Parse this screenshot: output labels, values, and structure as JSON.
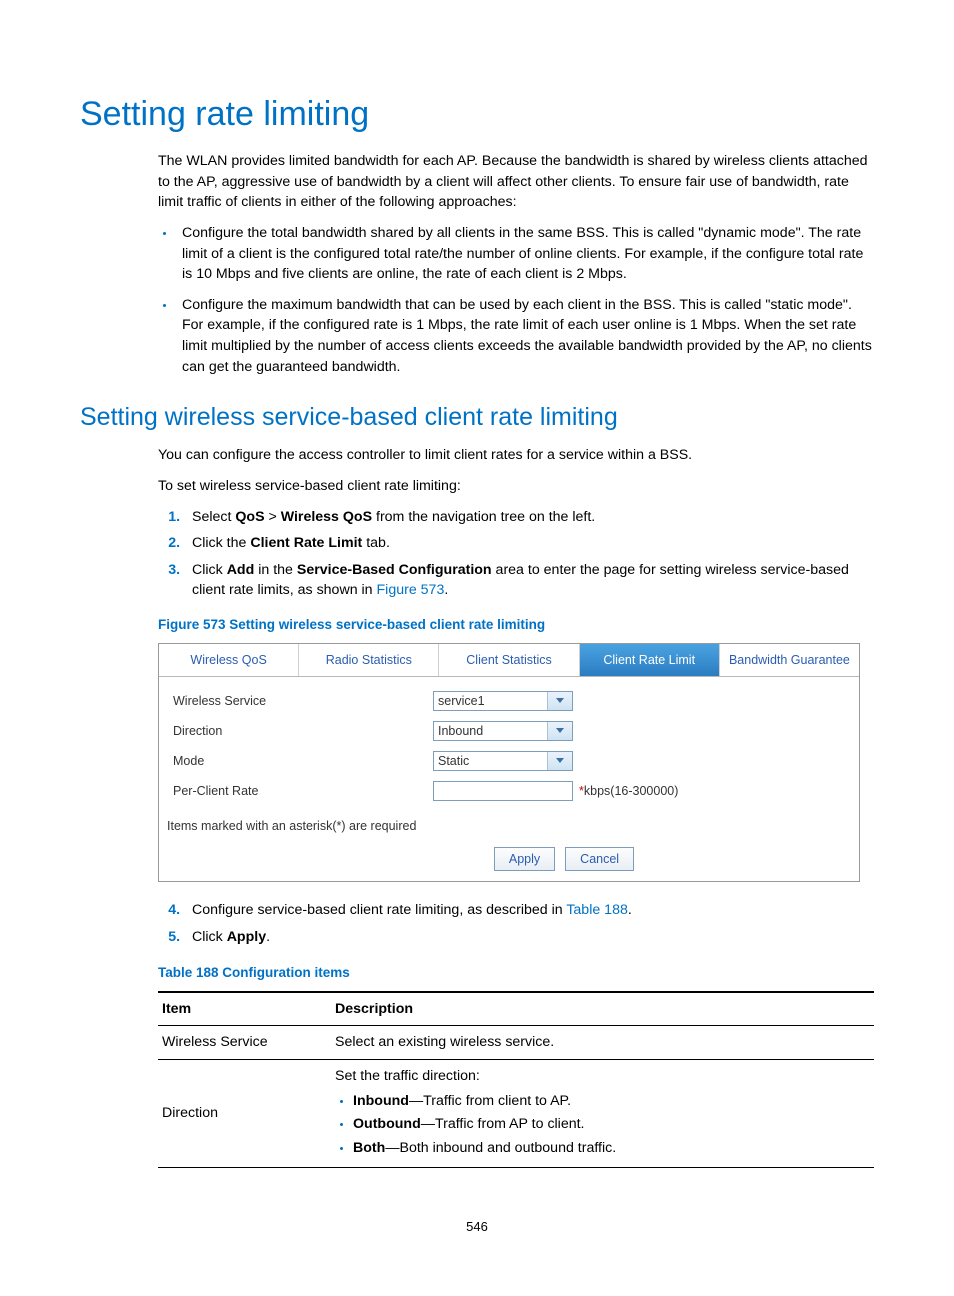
{
  "h1": "Setting rate limiting",
  "intro": "The WLAN provides limited bandwidth for each AP. Because the bandwidth is shared by wireless clients attached to the AP, aggressive use of bandwidth by a client will affect other clients. To ensure fair use of bandwidth, rate limit traffic of clients in either of the following approaches:",
  "bullets": [
    "Configure the total bandwidth shared by all clients in the same BSS. This is called \"dynamic mode\". The rate limit of a client is the configured total rate/the number of online clients. For example, if the configure total rate is 10 Mbps and five clients are online, the rate of each client is 2 Mbps.",
    "Configure the maximum bandwidth that can be used by each client in the BSS. This is called \"static mode\". For example, if the configured rate is 1 Mbps, the rate limit of each user online is 1 Mbps. When the set rate limit multiplied by the number of access clients exceeds the available bandwidth provided by the AP, no clients can get the guaranteed bandwidth."
  ],
  "h2": "Setting wireless service-based client rate limiting",
  "p2a": "You can configure the access controller to limit client rates for a service within a BSS.",
  "p2b": "To set wireless service-based client rate limiting:",
  "steps": {
    "s1_pre": "Select ",
    "s1_b1": "QoS",
    "s1_gt": " > ",
    "s1_b2": "Wireless QoS",
    "s1_post": " from the navigation tree on the left.",
    "s2_pre": "Click the ",
    "s2_b": "Client Rate Limit",
    "s2_post": " tab.",
    "s3_pre": "Click ",
    "s3_b1": "Add",
    "s3_mid": " in the ",
    "s3_b2": "Service-Based Configuration",
    "s3_post1": " area to enter the page for setting wireless service-based client rate limits, as shown in ",
    "s3_link": "Figure 573",
    "s3_post2": ".",
    "s4_pre": "Configure service-based client rate limiting, as described in ",
    "s4_link": "Table 188",
    "s4_post": ".",
    "s5_pre": "Click ",
    "s5_b": "Apply",
    "s5_post": "."
  },
  "figure_title": "Figure 573 Setting wireless service-based client rate limiting",
  "ui": {
    "tabs": [
      "Wireless QoS",
      "Radio Statistics",
      "Client Statistics",
      "Client Rate Limit",
      "Bandwidth Guarantee"
    ],
    "active_tab_index": 3,
    "rows": {
      "wireless_service": {
        "label": "Wireless Service",
        "value": "service1"
      },
      "direction": {
        "label": "Direction",
        "value": "Inbound"
      },
      "mode": {
        "label": "Mode",
        "value": "Static"
      },
      "per_client_rate": {
        "label": "Per-Client Rate",
        "value": "",
        "hint": "kbps(16-300000)"
      }
    },
    "note": "Items marked with an asterisk(*) are required",
    "apply": "Apply",
    "cancel": "Cancel"
  },
  "table_title": "Table 188 Configuration items",
  "table": {
    "h_item": "Item",
    "h_desc": "Description",
    "r1_item": "Wireless Service",
    "r1_desc": "Select an existing wireless service.",
    "r2_item": "Direction",
    "r2_intro": "Set the traffic direction:",
    "r2_b1_k": "Inbound",
    "r2_b1_v": "—Traffic from client to AP.",
    "r2_b2_k": "Outbound",
    "r2_b2_v": "—Traffic from AP to client.",
    "r2_b3_k": "Both",
    "r2_b3_v": "—Both inbound and outbound traffic."
  },
  "page_number": "546"
}
